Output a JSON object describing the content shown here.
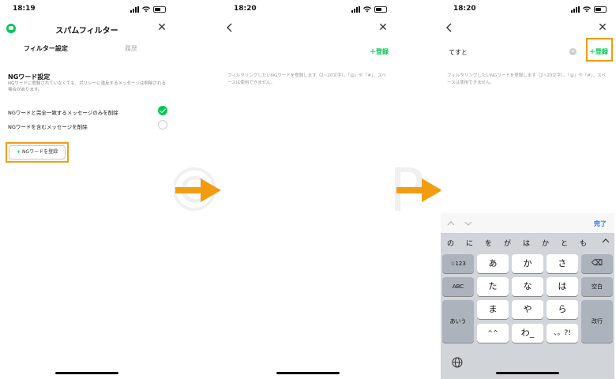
{
  "screens": [
    {
      "time": "18:19",
      "title": "スパムフィルター",
      "tabs": [
        "フィルター設定",
        "履歴"
      ],
      "section_title": "NGワード設定",
      "section_desc": "NGワードに登録されていなくても、ポリシーに違反するメッセージは削除される場合があります。",
      "options": [
        {
          "label": "NGワードと完全一致するメッセージのみを削除",
          "checked": true
        },
        {
          "label": "NGワードを含むメッセージを削除",
          "checked": false
        }
      ],
      "add_button": "NGワードを登録"
    },
    {
      "time": "18:20",
      "register_button": "登録",
      "helper": "フィルタリングしたいNGワードを登録します（2~20文字）。「@」や「#」、スペースは使用できません。"
    },
    {
      "time": "18:20",
      "register_button": "登録",
      "input_value": "てすと",
      "helper": "フィルタリングしたいNGワードを登録します（2~20文字）。「@」や「#」、スペースは使用できません。",
      "keyboard": {
        "done": "完了",
        "predictions": [
          "の",
          "に",
          "を",
          "が",
          "は",
          "か",
          "と",
          "も"
        ],
        "rows": [
          [
            "☆123",
            "あ",
            "か",
            "さ",
            "⌫"
          ],
          [
            "ABC",
            "た",
            "な",
            "は",
            "空白"
          ],
          [
            "あいう",
            "ま",
            "や",
            "ら",
            "改行"
          ],
          [
            "",
            "^^",
            "わ_",
            "、。?!",
            ""
          ]
        ]
      }
    }
  ],
  "colors": {
    "accent": "#06c755",
    "highlight": "#f39c12",
    "arrow": "#f39c12"
  }
}
